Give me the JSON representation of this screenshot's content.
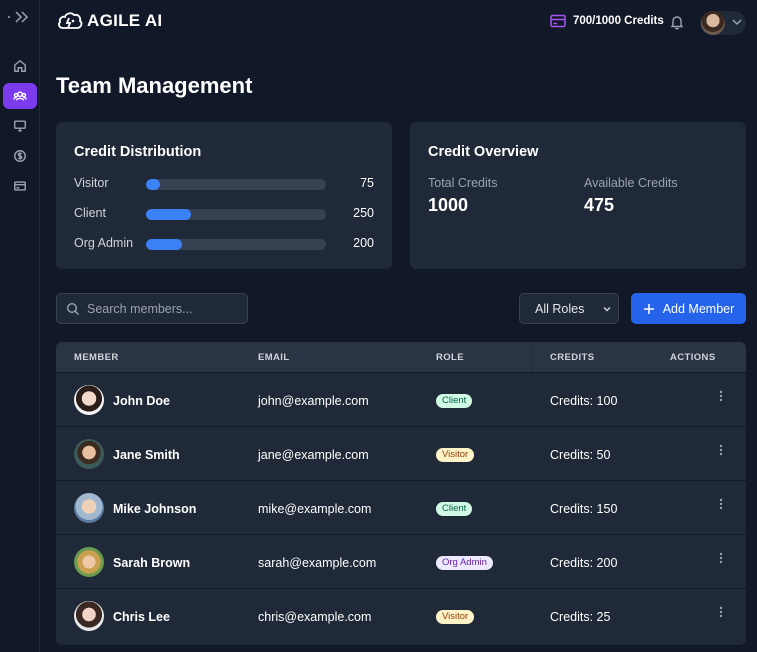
{
  "app": {
    "name": "AGILE AI"
  },
  "topbar": {
    "credits_label": "700/1000 Credits"
  },
  "page": {
    "title": "Team Management"
  },
  "sidebar": {
    "items": [
      {
        "icon": "home-icon"
      },
      {
        "icon": "team-icon",
        "active": true
      },
      {
        "icon": "monitor-icon"
      },
      {
        "icon": "dollar-icon"
      },
      {
        "icon": "card-icon"
      }
    ]
  },
  "distribution": {
    "title": "Credit Distribution",
    "max": 1000,
    "rows": [
      {
        "label": "Visitor",
        "value": "75",
        "fraction": 0.075
      },
      {
        "label": "Client",
        "value": "250",
        "fraction": 0.25
      },
      {
        "label": "Org Admin",
        "value": "200",
        "fraction": 0.2
      }
    ]
  },
  "overview": {
    "title": "Credit Overview",
    "total_label": "Total Credits",
    "total_value": "1000",
    "available_label": "Available Credits",
    "available_value": "475"
  },
  "controls": {
    "search_placeholder": "Search members...",
    "role_filter": "All Roles",
    "add_label": "Add Member"
  },
  "table": {
    "headers": [
      "MEMBER",
      "EMAIL",
      "ROLE",
      "CREDITS",
      "ACTIONS"
    ],
    "rows": [
      {
        "name": "John Doe",
        "email": "john@example.com",
        "role": "Client",
        "credits": "Credits: 100"
      },
      {
        "name": "Jane Smith",
        "email": "jane@example.com",
        "role": "Visitor",
        "credits": "Credits: 50"
      },
      {
        "name": "Mike Johnson",
        "email": "mike@example.com",
        "role": "Client",
        "credits": "Credits: 150"
      },
      {
        "name": "Sarah Brown",
        "email": "sarah@example.com",
        "role": "Org Admin",
        "credits": "Credits: 200"
      },
      {
        "name": "Chris Lee",
        "email": "chris@example.com",
        "role": "Visitor",
        "credits": "Credits: 25"
      }
    ]
  },
  "colors": {
    "background": "#111827",
    "card": "#1f2937",
    "accent_purple": "#7c3aed",
    "accent_blue": "#2563eb",
    "bar_blue": "#3b82f6"
  }
}
